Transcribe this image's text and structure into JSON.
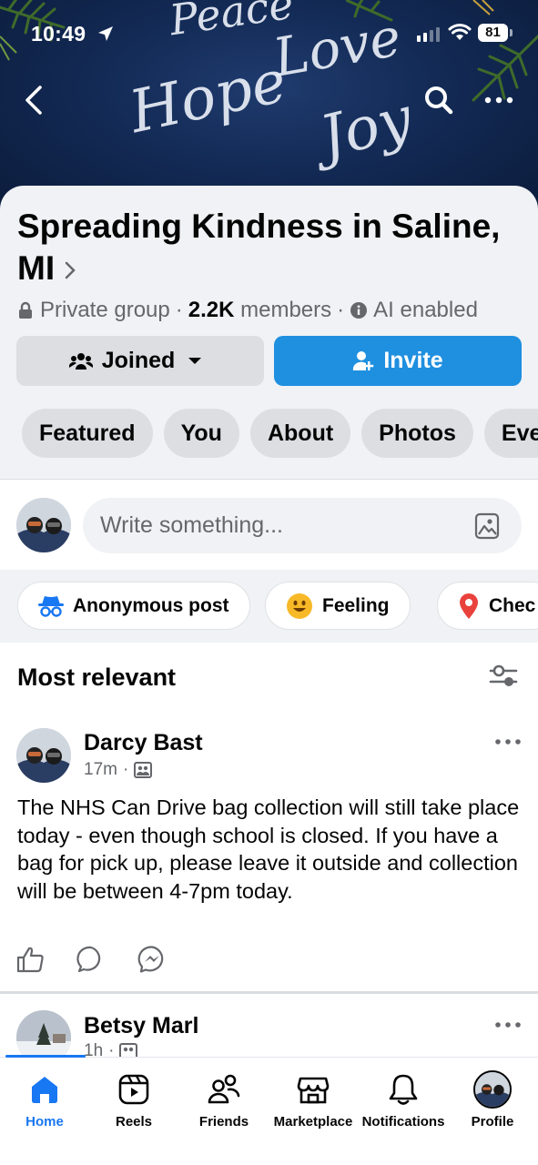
{
  "status_bar": {
    "time": "10:49",
    "battery": "81"
  },
  "cover": {
    "words": [
      "Peace",
      "Love",
      "Hope",
      "Joy"
    ]
  },
  "group": {
    "name": "Spreading Kindness in Saline, MI",
    "privacy": "Private group",
    "member_count": "2.2K",
    "members_label": "members",
    "ai_label": "AI enabled",
    "joined_label": "Joined",
    "invite_label": "Invite",
    "tabs": [
      "Featured",
      "You",
      "About",
      "Photos",
      "Eve"
    ]
  },
  "composer": {
    "placeholder": "Write something..."
  },
  "chips": {
    "anonymous": "Anonymous post",
    "feeling": "Feeling",
    "checkin": "Chec"
  },
  "feed": {
    "sort_label": "Most relevant"
  },
  "posts": [
    {
      "author": "Darcy Bast",
      "time": "17m",
      "body": "The NHS Can Drive bag collection will still take place today - even though school is closed.  If you have a bag for pick up, please leave it outside and collection will be between 4-7pm today."
    },
    {
      "author": "Betsy Marl",
      "time": "1h"
    }
  ],
  "nav": {
    "home": "Home",
    "reels": "Reels",
    "friends": "Friends",
    "marketplace": "Marketplace",
    "notifications": "Notifications",
    "profile": "Profile"
  },
  "colors": {
    "accent": "#1877f2",
    "invite_button": "#1f8fe0",
    "secondary_text": "#65676b",
    "chip_bg": "#dcdee2"
  }
}
